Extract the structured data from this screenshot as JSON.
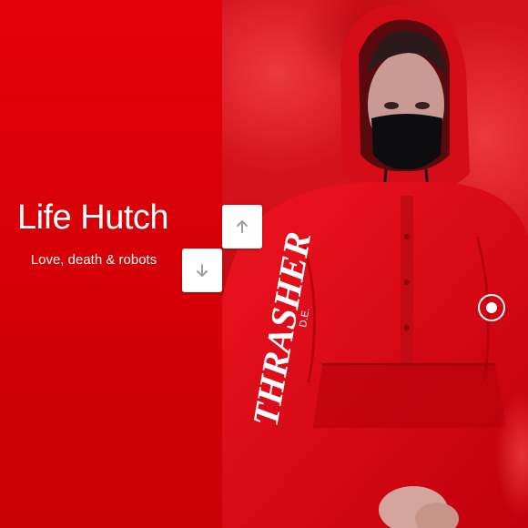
{
  "site": {
    "title": "Life Hutch",
    "tagline": "Love, death & robots"
  },
  "navigation": {
    "up_icon": "arrow-up-icon",
    "down_icon": "arrow-down-icon"
  },
  "hero_image": {
    "subject": "person in red hooded jacket with black face mask amid red smoke",
    "jacket_text": "THRASHER",
    "jacket_subtext": "D.E."
  },
  "colors": {
    "panel_red": "#d80007",
    "photo_red": "#d8161e",
    "button_bg": "#ffffff",
    "arrow_gray": "#9e9e9e"
  }
}
